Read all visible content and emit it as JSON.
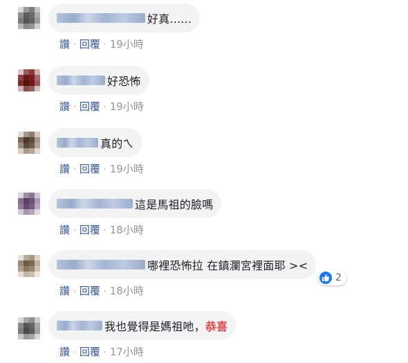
{
  "comments": [
    {
      "text": "好真......",
      "like_label": "讚",
      "reply_label": "回覆",
      "time": "19小時"
    },
    {
      "text": "好恐怖",
      "like_label": "讚",
      "reply_label": "回覆",
      "time": "19小時"
    },
    {
      "text": "真的ㄟ",
      "like_label": "讚",
      "reply_label": "回覆",
      "time": "19小時"
    },
    {
      "text": "這是馬祖的臉嗎",
      "like_label": "讚",
      "reply_label": "回覆",
      "time": "18小時"
    },
    {
      "text": "哪裡恐怖拉 在鎮瀾宮裡面耶 ><",
      "like_label": "讚",
      "reply_label": "回覆",
      "time": "18小時",
      "reaction": {
        "icon": "thumbs-up-icon",
        "count": "2",
        "color": "#1877f2"
      }
    },
    {
      "text": "我也覺得是媽祖吔，",
      "highlight": "恭喜",
      "highlight_color": "#e0494b",
      "like_label": "讚",
      "reply_label": "回覆",
      "time": "17小時"
    }
  ],
  "colors": {
    "bubble": "#f2f3f5",
    "action_link": "#385898",
    "timestamp": "#90949c"
  }
}
